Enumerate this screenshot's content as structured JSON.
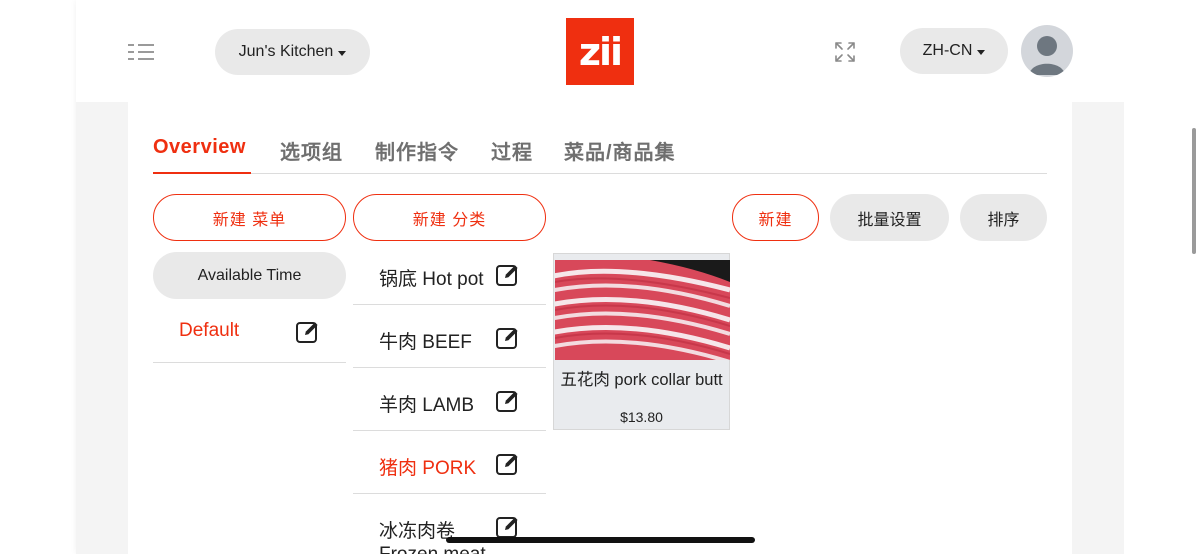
{
  "header": {
    "store_selector": "Jun's Kitchen",
    "logo_text": "zii",
    "language_selector": "ZH-CN"
  },
  "tabs": [
    {
      "label": "Overview",
      "active": true
    },
    {
      "label": "选项组",
      "active": false
    },
    {
      "label": "制作指令",
      "active": false
    },
    {
      "label": "过程",
      "active": false
    },
    {
      "label": "菜品/商品集",
      "active": false
    }
  ],
  "buttons": {
    "new_menu": "新建 菜单",
    "new_category": "新建 分类",
    "new_item": "新建",
    "batch_settings": "批量设置",
    "sort": "排序",
    "available_time": "Available Time"
  },
  "menus": [
    {
      "label": "Default",
      "active": true
    }
  ],
  "categories": [
    {
      "label": "锅底 Hot pot",
      "active": false
    },
    {
      "label": "牛肉 BEEF",
      "active": false
    },
    {
      "label": "羊肉 LAMB",
      "active": false
    },
    {
      "label": "猪肉 PORK",
      "active": true
    },
    {
      "label": "冰冻肉卷",
      "active": false
    },
    {
      "label": "Frozen meat",
      "active": false
    }
  ],
  "products": [
    {
      "name": "五花肉 pork collar butt",
      "price": "$13.80"
    }
  ],
  "colors": {
    "accent": "#ef2f10",
    "pill_gray": "#e9e9e9",
    "page_gray": "#f4f4f4"
  }
}
